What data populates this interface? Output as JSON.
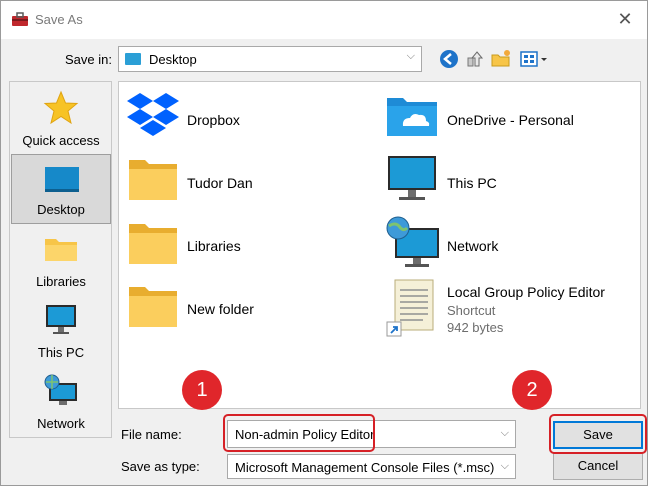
{
  "window": {
    "title": "Save As"
  },
  "save_in": {
    "label": "Save in:",
    "value": "Desktop"
  },
  "places": [
    {
      "label": "Quick access",
      "icon": "star-icon"
    },
    {
      "label": "Desktop",
      "icon": "desktop-icon",
      "selected": true
    },
    {
      "label": "Libraries",
      "icon": "libraries-icon"
    },
    {
      "label": "This PC",
      "icon": "computer-icon"
    },
    {
      "label": "Network",
      "icon": "network-icon"
    }
  ],
  "files": [
    {
      "name": "Dropbox",
      "icon": "dropbox-icon"
    },
    {
      "name": "OneDrive - Personal",
      "icon": "onedrive-folder-icon"
    },
    {
      "name": "Tudor Dan",
      "icon": "folder-icon"
    },
    {
      "name": "This PC",
      "icon": "computer-icon"
    },
    {
      "name": "Libraries",
      "icon": "folder-icon"
    },
    {
      "name": "Network",
      "icon": "network-icon"
    },
    {
      "name": "New folder",
      "icon": "folder-icon"
    },
    {
      "name": "Local Group Policy Editor",
      "type": "Shortcut",
      "size": "942 bytes",
      "icon": "shortcut-icon"
    }
  ],
  "form": {
    "file_name_label": "File name:",
    "file_name_value": "Non-admin Policy Editor",
    "save_type_label": "Save as type:",
    "save_type_value": "Microsoft Management Console Files (*.msc)"
  },
  "buttons": {
    "save": "Save",
    "cancel": "Cancel"
  },
  "callouts": [
    "1",
    "2"
  ],
  "colors": {
    "callout": "#e0262b",
    "accent": "#0078d7",
    "folder": "#f7c548"
  }
}
